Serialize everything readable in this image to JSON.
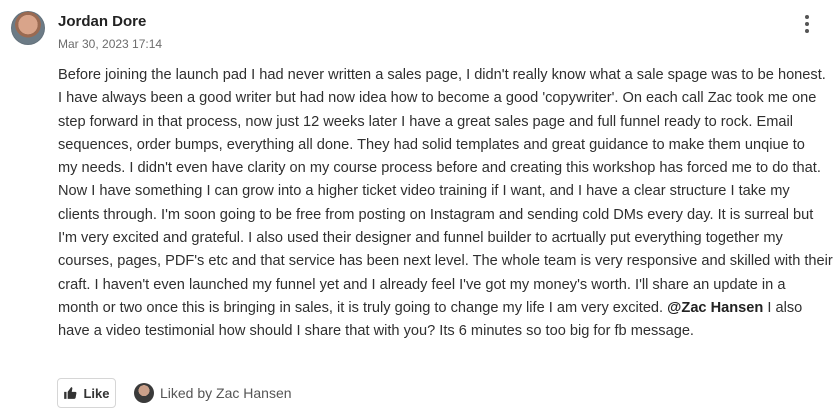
{
  "post": {
    "author": "Jordan Dore",
    "date": "Mar 30, 2023 17:14",
    "lines": [
      "Before joining the launch pad I had never written a sales page, I didn't really know what a sale spage was to be honest.",
      "I have always been a good writer but had now idea how to become a good 'copywriter'. On each call Zac took me one",
      "step forward in that process, now just 12 weeks later I have a great sales page and full funnel ready to rock. Email",
      "sequences, order bumps, everything all done. They had solid templates and great guidance to make them unqiue to",
      "my needs. I didn't even have clarity on my course process before and creating this workshop has forced me to do that.",
      "Now I have something I can grow into a higher ticket video training if I want, and I have a clear structure I take my",
      "clients through. I'm soon going to be free from posting on Instagram and sending cold DMs every day. It is surreal but",
      "I'm very excited and grateful. I also used their designer and funnel builder to acrtually put everything together my",
      "courses, pages, PDF's etc and that service has been next level. The whole team is very responsive and skilled with their",
      "craft. I haven't even launched my funnel yet and I already feel I've got my money's worth. I'll share an update in a"
    ],
    "line11_before": "month or two once this is bringing in sales, it is truly going to change my life I am very excited.",
    "mention": "@Zac Hansen",
    "line11_after": "I also",
    "line12": "have a video testimonial how should I share that with you? Its 6 minutes so too big for fb message."
  },
  "actions": {
    "like_label": "Like",
    "liked_by": "Liked by Zac Hansen"
  },
  "icons": {
    "menu": "vertical-ellipsis-icon",
    "like": "thumbs-up-icon"
  }
}
